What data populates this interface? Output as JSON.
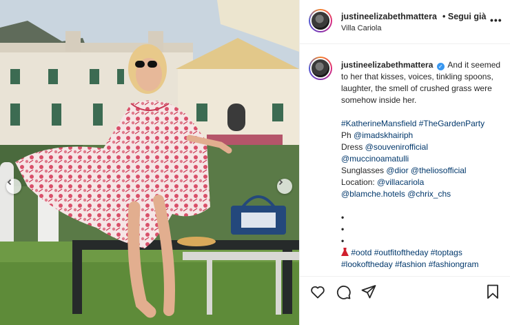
{
  "post": {
    "username": "justineelizabethmattera",
    "separator": "•",
    "follow_label": "Segui già",
    "location": "Villa Cariola",
    "more_label": "•••"
  },
  "caption": {
    "username": "justineelizabethmattera",
    "verified_mark": "✓",
    "line1": "And it seemed to her that kisses, voices, tinkling spoons, laughter, the smell of crushed grass were somehow inside her.",
    "hashtags_line": "#KatherineMansfield #TheGardenParty",
    "ph_label": "Ph ",
    "ph_handle": "@imadskhairiph",
    "dress_label": "Dress ",
    "dress_handle1": "@souvenirofficial",
    "dress_handle2": "@muccinoamatulli",
    "sunglasses_label": "Sunglasses ",
    "sunglasses_handle1": "@dior",
    "sunglasses_handle2": "@theliosofficial",
    "location_label": "Location: ",
    "location_handle": "@villacariola",
    "handle_blamche": "@blamche.hotels",
    "handle_chrix": "@chrix_chs",
    "dot": "•",
    "tag1": "#ootd",
    "tag2": "#outfitoftheday",
    "tag3": "#toptags",
    "tag4": "#lookoftheday",
    "tag5": "#fashion",
    "tag6": "#fashiongram"
  },
  "icons": {
    "like": "heart-icon",
    "comment": "comment-icon",
    "share": "paper-plane-icon",
    "save": "bookmark-icon",
    "prev": "chevron-left-icon",
    "next": "chevron-right-icon"
  },
  "colors": {
    "link": "#00376b",
    "verified": "#3897f0",
    "dress_pink": "#e3687a"
  }
}
